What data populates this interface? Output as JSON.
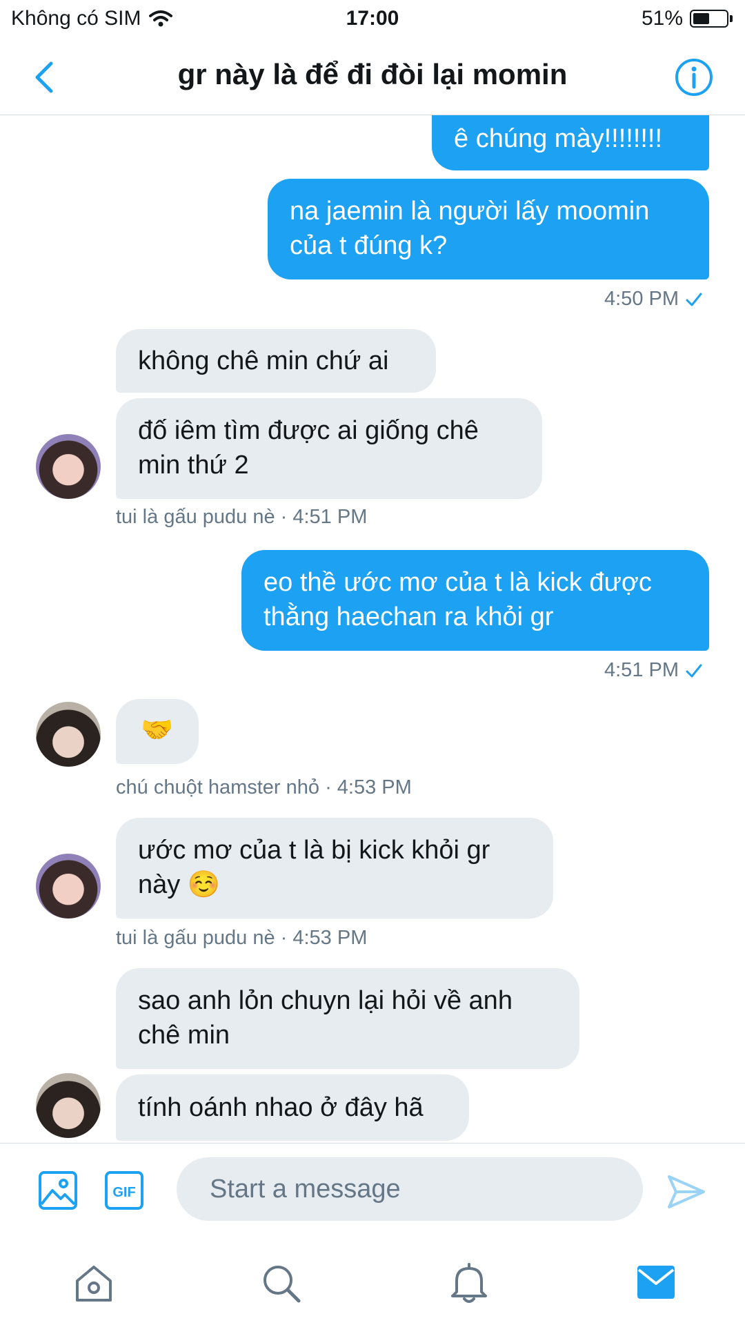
{
  "status_bar": {
    "carrier": "Không có SIM",
    "time": "17:00",
    "battery_text": "51%",
    "battery_level": 0.51
  },
  "header": {
    "title": "gr này là để đi đòi lại momin"
  },
  "messages": [
    {
      "text": "ê chúng mày!!!!!!!!"
    },
    {
      "text": "na jaemin là người lấy moomin của t đúng k?",
      "timestamp": "4:50 PM"
    },
    {
      "text": "không chê min chứ ai"
    },
    {
      "text": "đố iêm tìm được ai giống chê min thứ 2",
      "meta": "tui là gấu pudu nè · 4:51 PM"
    },
    {
      "text": "eo thề ước mơ của t là kick được thằng haechan ra khỏi gr",
      "timestamp": "4:51 PM"
    },
    {
      "text": "🤝",
      "meta": "chú chuột hamster nhỏ · 4:53 PM"
    },
    {
      "text": "ước mơ của t là bị kick khỏi gr này ☺️",
      "meta": "tui là gấu pudu nè · 4:53 PM"
    },
    {
      "text": "sao anh lỏn chuyn lại hỏi về anh chê min"
    },
    {
      "text": "tính oánh nhao ở đây hã"
    }
  ],
  "composer": {
    "placeholder": "Start a message",
    "gif_label": "GIF"
  },
  "colors": {
    "accent": "#1da1f2",
    "incoming_bubble": "#e6ecf0",
    "meta_text": "#657786"
  },
  "icons": [
    "chevron-left-icon",
    "info-icon",
    "image-icon",
    "gif-icon",
    "send-icon",
    "home-icon",
    "search-icon",
    "bell-icon",
    "mail-icon"
  ]
}
